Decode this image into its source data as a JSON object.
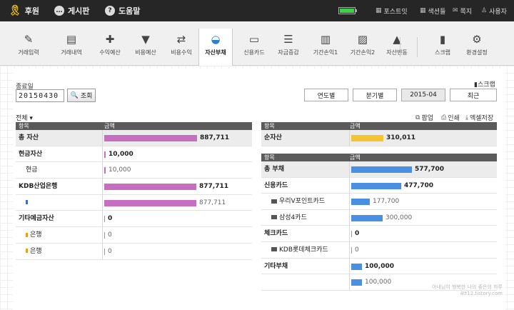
{
  "topbar": {
    "ribbon_label": "후원",
    "board_label": "게시판",
    "help_label": "도움말",
    "battery_level": 1.0,
    "postit": "포스트잇",
    "colorset": "색션들",
    "note": "쪽지",
    "user": "사용자"
  },
  "toolbar": [
    {
      "label": "거래입력",
      "icon": "✎"
    },
    {
      "label": "거래내역",
      "icon": "▤"
    },
    {
      "label": "수익예산",
      "icon": "✚"
    },
    {
      "label": "비용예산",
      "icon": "▼"
    },
    {
      "label": "비용수익",
      "icon": "⇄"
    },
    {
      "label": "자산부채",
      "icon": "◒"
    },
    {
      "label": "신용카드",
      "icon": "▭"
    },
    {
      "label": "자금증감",
      "icon": "☰"
    },
    {
      "label": "기간손익1",
      "icon": "▥"
    },
    {
      "label": "기간손익2",
      "icon": "▨"
    },
    {
      "label": "자산변동",
      "icon": "▲"
    },
    {
      "label": "스크랩",
      "icon": "▮"
    },
    {
      "label": "환경설정",
      "icon": "⚙"
    }
  ],
  "query": {
    "date_label": "종료일",
    "date_value": "20150430",
    "search_label": "조회",
    "scrap_label": "스크랩",
    "periods": [
      "연도별",
      "분기별",
      "2015-04",
      "최근"
    ],
    "selected_period": "2015-04",
    "all_label": "전체 ▾"
  },
  "actions": {
    "popup": "팝업",
    "print": "인쇄",
    "excel": "엑셀저장"
  },
  "headers": {
    "item": "항목",
    "amount": "금액"
  },
  "assets": {
    "max": 887711,
    "color": "#c66fc0",
    "rows": [
      {
        "name": "총 자산",
        "amount": "887,711",
        "value": 887711,
        "level": 0,
        "bold": true,
        "shade": true,
        "amt_bold": true
      },
      {
        "name": "현금자산",
        "amount": "10,000",
        "value": 10000,
        "level": 0,
        "bold": true,
        "shade": false,
        "amt_bold": true
      },
      {
        "name": "현금",
        "amount": "10,000",
        "value": 10000,
        "level": 1,
        "bold": false,
        "shade": false,
        "amt_bold": false
      },
      {
        "name": "KDB산업은행",
        "amount": "877,711",
        "value": 877711,
        "level": 0,
        "bold": true,
        "shade": false,
        "amt_bold": true
      },
      {
        "name": "",
        "amount": "877,711",
        "value": 877711,
        "level": 1,
        "bold": false,
        "shade": false,
        "amt_bold": false
      },
      {
        "name": "기타예금자산",
        "amount": "0",
        "value": 0,
        "level": 0,
        "bold": true,
        "shade": false,
        "amt_bold": true
      },
      {
        "name": "은행",
        "amount": "0",
        "value": 0,
        "level": 1,
        "bold": false,
        "shade": false,
        "amt_bold": false
      },
      {
        "name": "은행",
        "amount": "0",
        "value": 0,
        "level": 1,
        "bold": false,
        "shade": false,
        "amt_bold": false
      }
    ]
  },
  "net": {
    "name": "순자산",
    "amount": "310,011",
    "value": 310011,
    "max": 887711,
    "color": "#f4c531"
  },
  "liabilities": {
    "max": 887711,
    "color": "#4a90e2",
    "rows": [
      {
        "name": "총 부채",
        "amount": "577,700",
        "value": 577700,
        "level": 0,
        "bold": true,
        "shade": true,
        "amt_bold": true,
        "icon": false
      },
      {
        "name": "신용카드",
        "amount": "477,700",
        "value": 477700,
        "level": 0,
        "bold": true,
        "shade": false,
        "amt_bold": true,
        "icon": false
      },
      {
        "name": "우리V포인트카드",
        "amount": "177,700",
        "value": 177700,
        "level": 1,
        "bold": false,
        "shade": false,
        "amt_bold": false,
        "icon": true
      },
      {
        "name": "삼성4카드",
        "amount": "300,000",
        "value": 300000,
        "level": 1,
        "bold": false,
        "shade": false,
        "amt_bold": false,
        "icon": true
      },
      {
        "name": "체크카드",
        "amount": "0",
        "value": 0,
        "level": 0,
        "bold": true,
        "shade": false,
        "amt_bold": true,
        "icon": false
      },
      {
        "name": "KDB롯데체크카드",
        "amount": "0",
        "value": 0,
        "level": 1,
        "bold": false,
        "shade": false,
        "amt_bold": false,
        "icon": true
      },
      {
        "name": "기타부채",
        "amount": "100,000",
        "value": 100000,
        "level": 0,
        "bold": true,
        "shade": false,
        "amt_bold": true,
        "icon": false
      },
      {
        "name": "",
        "amount": "100,000",
        "value": 100000,
        "level": 1,
        "bold": false,
        "shade": false,
        "amt_bold": false,
        "icon": false
      }
    ]
  },
  "watermark": {
    "line1": "아내님이 행복한 나의 좋은의 하루",
    "line2": "4tt12.tistory.com"
  }
}
